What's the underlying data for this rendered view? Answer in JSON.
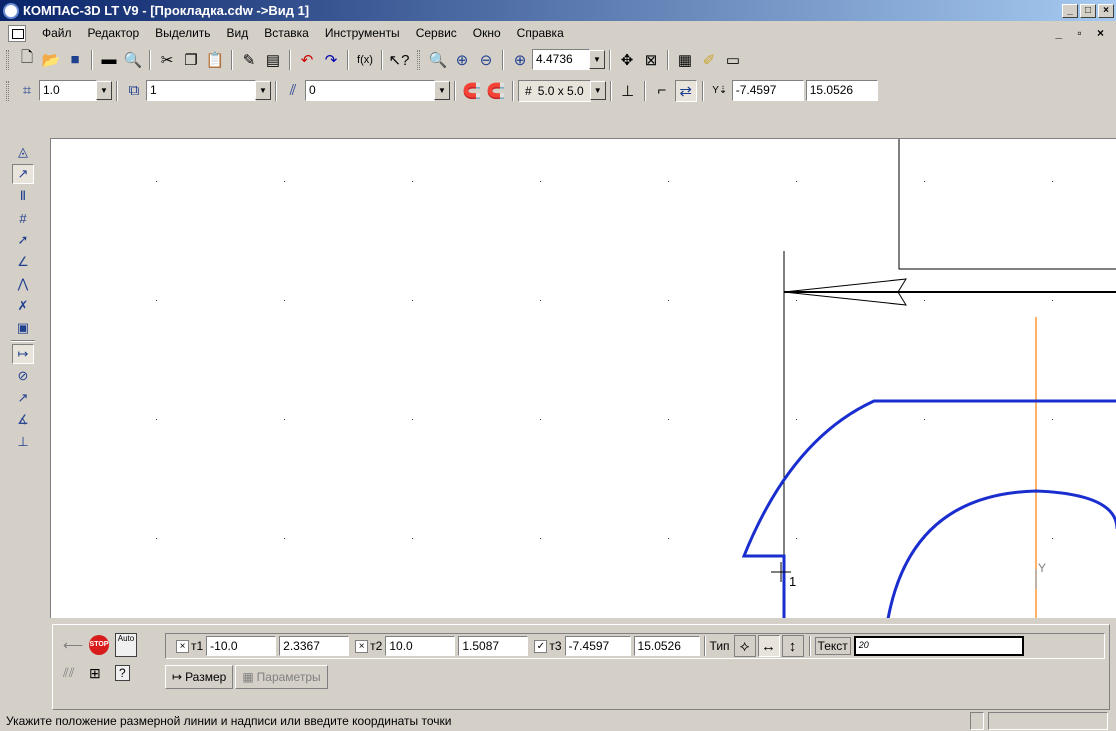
{
  "window": {
    "title": "КОМПАС-3D LT V9 - [Прокладка.cdw ->Вид 1]"
  },
  "menu": [
    {
      "label": "Файл"
    },
    {
      "label": "Редактор"
    },
    {
      "label": "Выделить"
    },
    {
      "label": "Вид"
    },
    {
      "label": "Вставка"
    },
    {
      "label": "Инструменты"
    },
    {
      "label": "Сервис"
    },
    {
      "label": "Окно"
    },
    {
      "label": "Справка"
    }
  ],
  "toolbar1": {
    "zoom_value": "4.4736"
  },
  "toolbar2": {
    "line_width": "1.0",
    "layer_value": "1",
    "style_value": "0",
    "grid_step": "5.0 x 5.0",
    "coord_x": "-7.4597",
    "coord_y": "15.0526"
  },
  "canvas": {
    "point_label": "1",
    "axis_label": "Y"
  },
  "propbar": {
    "t1_label": "т1",
    "t1_x": "-10.0",
    "t1_y": "2.3367",
    "t2_label": "т2",
    "t2_x": "10.0",
    "t2_y": "1.5087",
    "t3_label": "т3",
    "t3_x": "-7.4597",
    "t3_y": "15.0526",
    "type_label": "Тип",
    "text_label": "Текст",
    "text_value": "20",
    "auto_label": "Auto",
    "stop_label": "STOP",
    "tab_size": "Размер",
    "tab_params": "Параметры"
  },
  "status": {
    "message": "Укажите положение размерной линии и надписи или введите координаты точки"
  },
  "colors": {
    "geometry": "#1a2ecf",
    "axis": "#ff8000",
    "titlebar": "#0a246a"
  }
}
